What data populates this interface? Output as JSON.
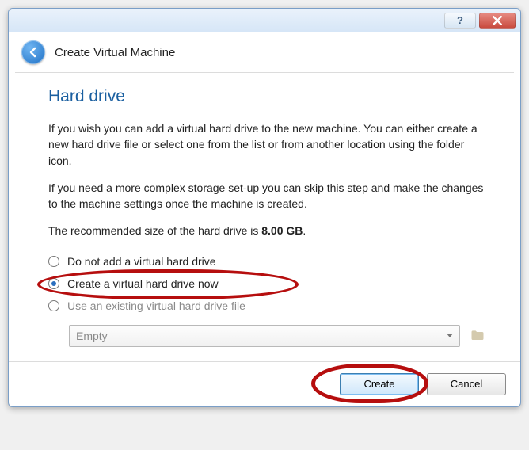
{
  "wizard": {
    "title": "Create Virtual Machine",
    "page_title": "Hard drive",
    "para1": "If you wish you can add a virtual hard drive to the new machine. You can either create a new hard drive file or select one from the list or from another location using the folder icon.",
    "para2": "If you need a more complex storage set-up you can skip this step and make the changes to the machine settings once the machine is created.",
    "rec_prefix": "The recommended size of the hard drive is ",
    "rec_value": "8.00 GB",
    "rec_suffix": "."
  },
  "options": {
    "opt1": "Do not add a virtual hard drive",
    "opt2": "Create a virtual hard drive now",
    "opt3": "Use an existing virtual hard drive file",
    "select_value": "Empty"
  },
  "buttons": {
    "create": "Create",
    "cancel": "Cancel",
    "help": "?"
  }
}
